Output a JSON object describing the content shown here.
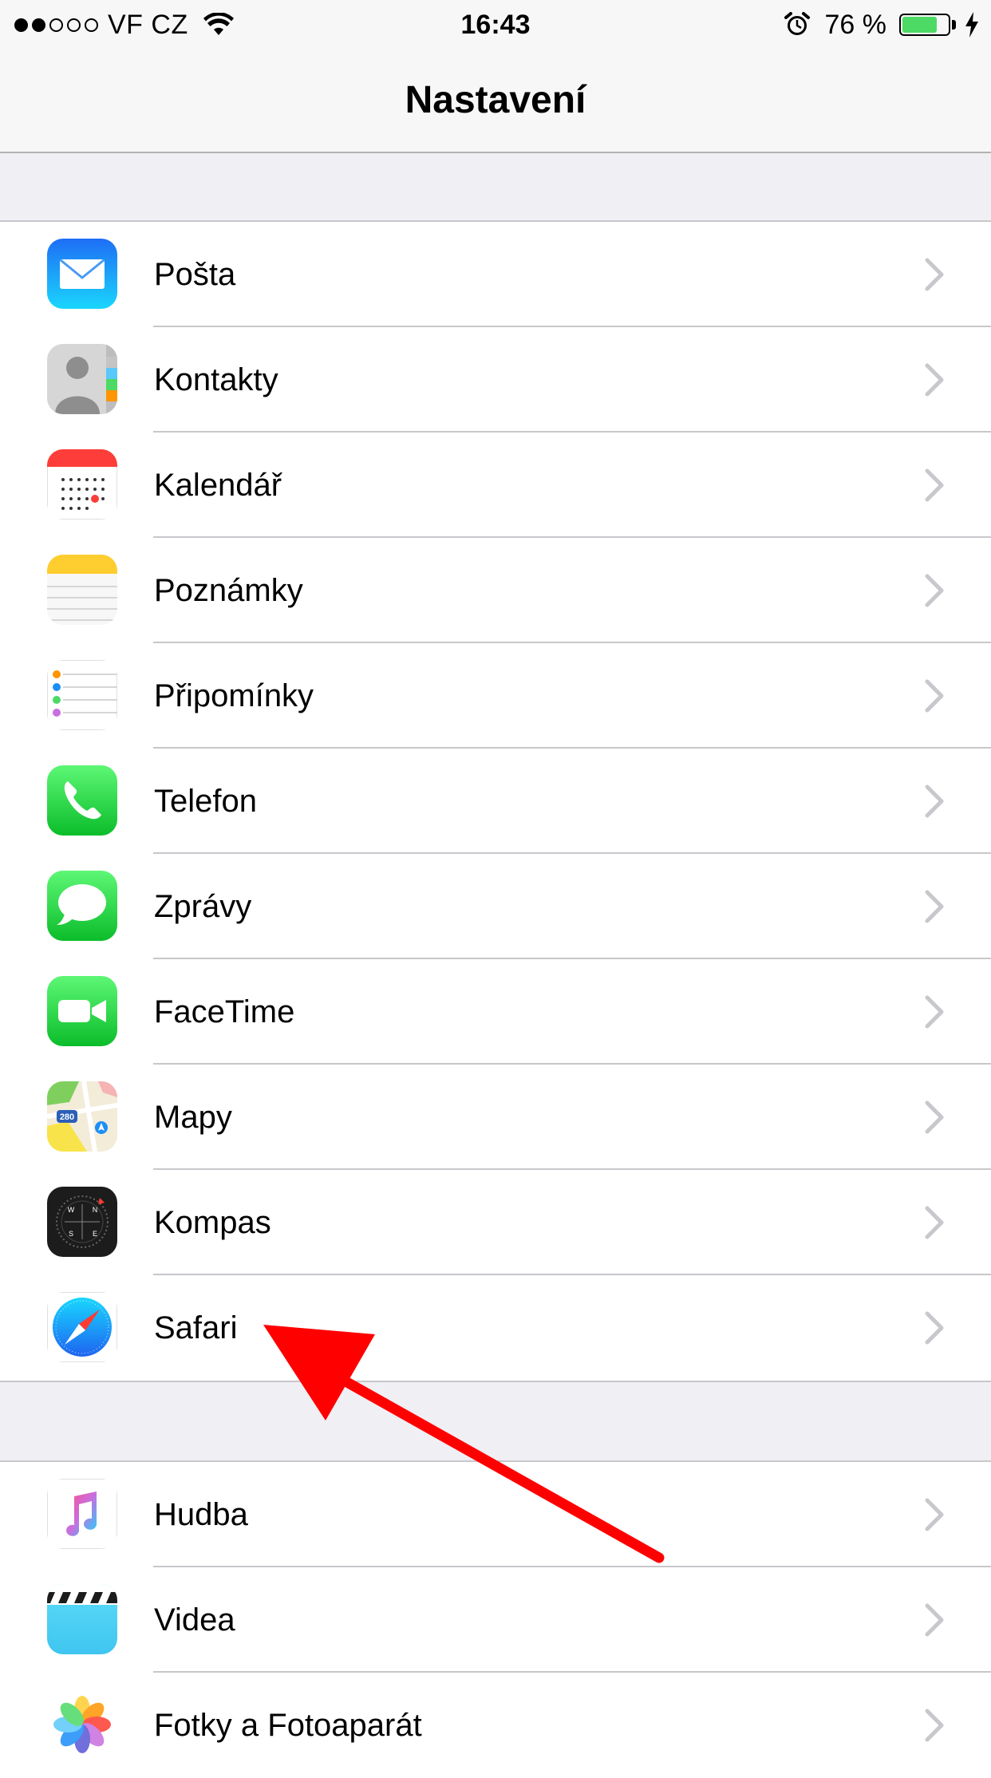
{
  "status_bar": {
    "carrier": "VF CZ",
    "time": "16:43",
    "battery_percent": "76 %",
    "battery_level": 0.76,
    "signal_bars_filled": 2,
    "signal_bars_total": 5
  },
  "nav": {
    "title": "Nastavení"
  },
  "group1": [
    {
      "label": "Pošta",
      "icon": "mail-icon"
    },
    {
      "label": "Kontakty",
      "icon": "contacts-icon"
    },
    {
      "label": "Kalendář",
      "icon": "calendar-icon"
    },
    {
      "label": "Poznámky",
      "icon": "notes-icon"
    },
    {
      "label": "Připomínky",
      "icon": "reminders-icon"
    },
    {
      "label": "Telefon",
      "icon": "phone-icon"
    },
    {
      "label": "Zprávy",
      "icon": "messages-icon"
    },
    {
      "label": "FaceTime",
      "icon": "facetime-icon"
    },
    {
      "label": "Mapy",
      "icon": "maps-icon"
    },
    {
      "label": "Kompas",
      "icon": "compass-icon"
    },
    {
      "label": "Safari",
      "icon": "safari-icon"
    }
  ],
  "group2": [
    {
      "label": "Hudba",
      "icon": "music-icon"
    },
    {
      "label": "Videa",
      "icon": "videos-icon"
    },
    {
      "label": "Fotky a Fotoaparát",
      "icon": "photos-icon"
    }
  ],
  "annotation": {
    "type": "arrow",
    "color": "#ff0000",
    "points_to": "Safari"
  },
  "colors": {
    "background": "#efeff4",
    "separator": "#c8c7cc",
    "chevron": "#c7c7cc",
    "battery": "#4cd964"
  }
}
